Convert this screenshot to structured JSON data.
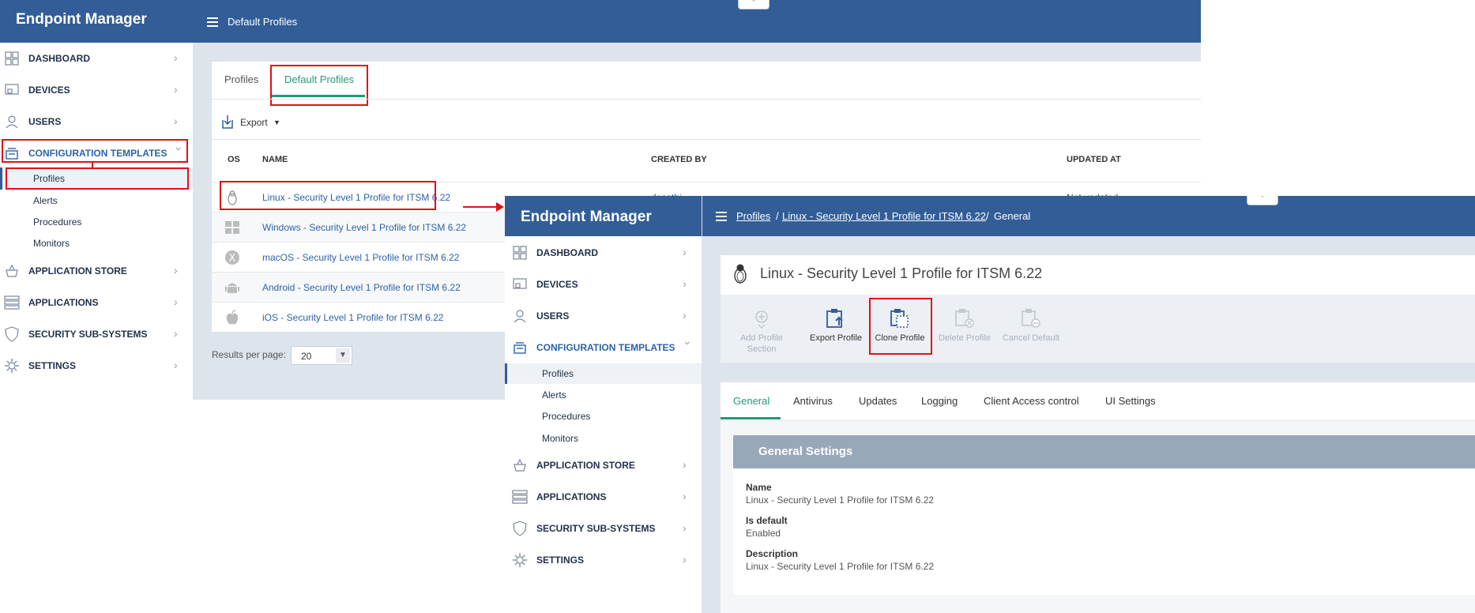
{
  "app": {
    "brand": "Endpoint Manager"
  },
  "window1": {
    "header_title": "Default Profiles",
    "nav": [
      {
        "label": "DASHBOARD"
      },
      {
        "label": "DEVICES"
      },
      {
        "label": "USERS"
      },
      {
        "label": "CONFIGURATION TEMPLATES"
      },
      {
        "label": "APPLICATION STORE"
      },
      {
        "label": "APPLICATIONS"
      },
      {
        "label": "SECURITY SUB-SYSTEMS"
      },
      {
        "label": "SETTINGS"
      }
    ],
    "subnav": [
      "Profiles",
      "Alerts",
      "Procedures",
      "Monitors"
    ],
    "tabs": [
      "Profiles",
      "Default Profiles"
    ],
    "export_label": "Export",
    "columns": [
      "OS",
      "NAME",
      "CREATED BY",
      "UPDATED AT"
    ],
    "rows": [
      {
        "os": "linux-icon",
        "name": "Linux - Security Level 1 Profile for ITSM 6.22",
        "created_by": "desathi",
        "updated_at": "Not updated"
      },
      {
        "os": "windows-icon",
        "name": "Windows - Security Level 1 Profile for ITSM 6.22"
      },
      {
        "os": "macos-icon",
        "name": "macOS - Security Level 1 Profile for ITSM 6.22"
      },
      {
        "os": "android-icon",
        "name": "Android - Security Level 1 Profile for ITSM 6.22"
      },
      {
        "os": "apple-icon",
        "name": "iOS - Security Level 1 Profile for ITSM 6.22"
      }
    ],
    "results_per_page_label": "Results per page:",
    "results_per_page_value": "20"
  },
  "window2": {
    "breadcrumb": [
      "Profiles",
      "Linux - Security Level 1 Profile for ITSM 6.22",
      "General"
    ],
    "breadcrumb_sep": "/",
    "profile_title": "Linux - Security Level 1 Profile for ITSM 6.22",
    "toolbar": {
      "add_section_line1": "Add Profile",
      "add_section_line2": "Section",
      "export": "Export Profile",
      "clone": "Clone Profile",
      "delete": "Delete Profile",
      "cancel_default": "Cancel Default"
    },
    "tabs": [
      "General",
      "Antivirus",
      "Updates",
      "Logging",
      "Client Access control",
      "UI Settings"
    ],
    "section_title": "General Settings",
    "fields": {
      "name_label": "Name",
      "name_value": "Linux - Security Level 1 Profile for ITSM 6.22",
      "default_label": "Is default",
      "default_value": "Enabled",
      "desc_label": "Description",
      "desc_value": "Linux - Security Level 1 Profile for ITSM 6.22"
    }
  },
  "colors": {
    "primary": "#325d97",
    "accent_green": "#1f9b7a",
    "highlight_red": "#e0111a",
    "link_blue": "#2c62a8",
    "panel_grey": "#dde4ec"
  }
}
